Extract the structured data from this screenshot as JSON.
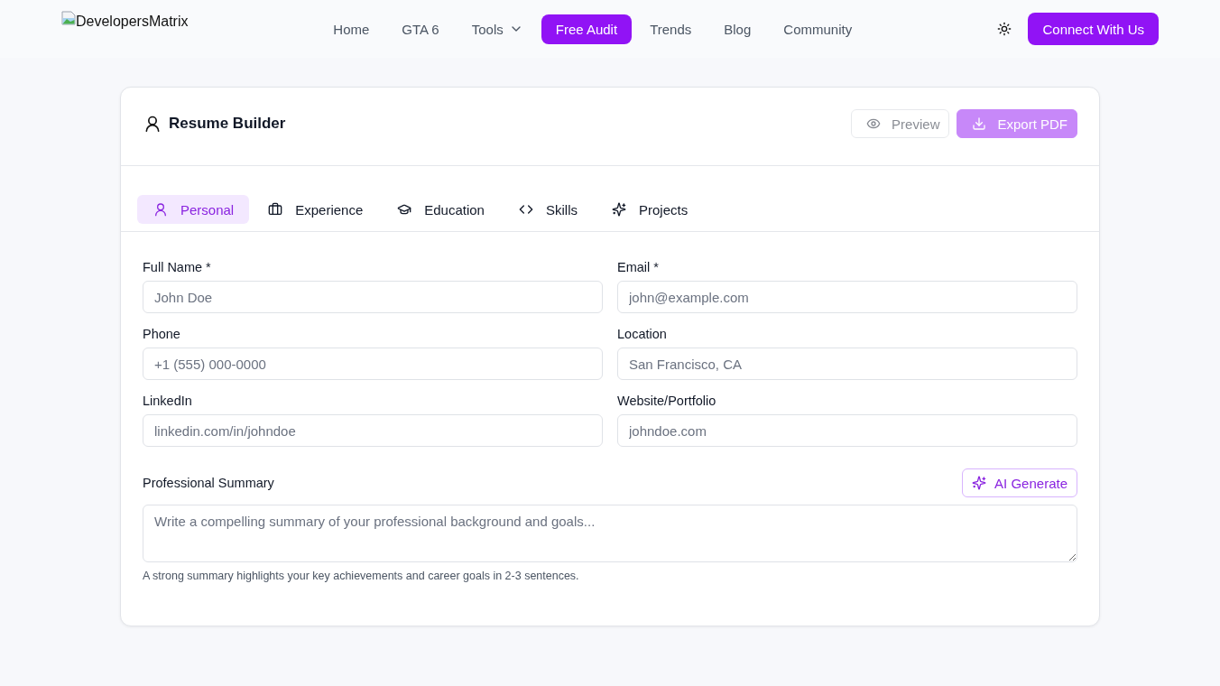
{
  "header": {
    "logo_text": "DevelopersMatrix",
    "nav": [
      {
        "label": "Home",
        "kind": "link",
        "selected": false
      },
      {
        "label": "GTA 6",
        "kind": "link",
        "selected": false
      },
      {
        "label": "Tools",
        "kind": "dropdown",
        "selected": false
      },
      {
        "label": "Free Audit",
        "kind": "link",
        "selected": true
      },
      {
        "label": "Trends",
        "kind": "link",
        "selected": false
      },
      {
        "label": "Blog",
        "kind": "link",
        "selected": false
      },
      {
        "label": "Community",
        "kind": "link",
        "selected": false
      }
    ],
    "cta": "Connect With Us"
  },
  "resume_builder": {
    "title": "Resume Builder",
    "actions": [
      {
        "label": "Preview",
        "kind": "outline",
        "disabled": true
      },
      {
        "label": "Export PDF",
        "kind": "primary",
        "disabled": true
      }
    ],
    "tabs": [
      {
        "label": "Personal",
        "selected": true
      },
      {
        "label": "Experience",
        "selected": false
      },
      {
        "label": "Education",
        "selected": false
      },
      {
        "label": "Skills",
        "selected": false
      },
      {
        "label": "Projects",
        "selected": false
      }
    ],
    "fields": [
      {
        "label": "Full Name *",
        "placeholder": "John Doe"
      },
      {
        "label": "Email *",
        "placeholder": "john@example.com"
      },
      {
        "label": "Phone",
        "placeholder": "+1 (555) 000-0000"
      },
      {
        "label": "Location",
        "placeholder": "San Francisco, CA"
      },
      {
        "label": "LinkedIn",
        "placeholder": "linkedin.com/in/johndoe"
      },
      {
        "label": "Website/Portfolio",
        "placeholder": "johndoe.com"
      }
    ],
    "summary": {
      "label": "Professional Summary",
      "ai_button": "AI Generate",
      "placeholder": "Write a compelling summary of your professional background and goals...",
      "hint": "A strong summary highlights your key achievements and career goals in 2-3 sentences."
    }
  }
}
